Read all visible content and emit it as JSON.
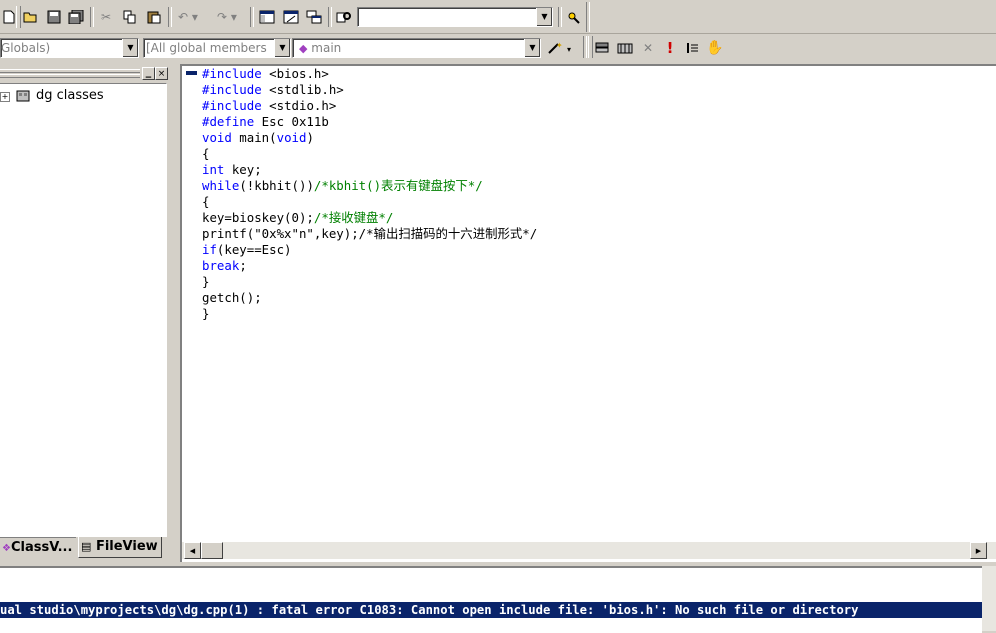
{
  "toolbar1": {
    "find_combo_value": "",
    "icons": [
      "new-file-icon",
      "open-icon",
      "save-icon",
      "save-all-icon",
      "cut-icon",
      "copy-icon",
      "paste-icon",
      "undo-icon",
      "redo-icon",
      "workspace-icon",
      "output-window-icon",
      "window-list-icon",
      "find-in-files-icon",
      "find-icon",
      "help-icon"
    ]
  },
  "toolbar2": {
    "scope_combo": "Globals)",
    "members_combo": "[All global members",
    "function_combo": "main",
    "icons": [
      "wizard-icon",
      "compile-icon",
      "build-icon",
      "stop-build-icon",
      "execute-icon",
      "breakpoint-icon",
      "go-icon"
    ]
  },
  "left_pane": {
    "tree_root": "dg classes",
    "tabs": [
      {
        "label": "ClassV...",
        "icon": "class-view-icon"
      },
      {
        "label": "FileView",
        "icon": "file-view-icon"
      }
    ]
  },
  "editor": {
    "lines": [
      [
        {
          "t": "#include",
          "c": "kw"
        },
        {
          "t": " <bios.h>"
        }
      ],
      [
        {
          "t": "#include",
          "c": "kw"
        },
        {
          "t": " <stdlib.h>"
        }
      ],
      [
        {
          "t": "#include",
          "c": "kw"
        },
        {
          "t": " <stdio.h>"
        }
      ],
      [
        {
          "t": "#define",
          "c": "kw"
        },
        {
          "t": " Esc 0x11b"
        }
      ],
      [
        {
          "t": "void",
          "c": "kw"
        },
        {
          "t": " main("
        },
        {
          "t": "void",
          "c": "kw"
        },
        {
          "t": ")"
        }
      ],
      [
        {
          "t": "{"
        }
      ],
      [
        {
          "t": "int",
          "c": "kw"
        },
        {
          "t": " key;"
        }
      ],
      [
        {
          "t": "while",
          "c": "kw"
        },
        {
          "t": "(!kbhit())"
        },
        {
          "t": "/*kbhit()表示有键盘按下*/",
          "c": "cm"
        }
      ],
      [
        {
          "t": "{"
        }
      ],
      [
        {
          "t": "key=bioskey(0);"
        },
        {
          "t": "/*接收键盘*/",
          "c": "cm"
        }
      ],
      [
        {
          "t": "printf(\"0x%x\"n\",key);/*输出扫描码的十六进制形式*/"
        }
      ],
      [
        {
          "t": "if",
          "c": "kw"
        },
        {
          "t": "(key==Esc)"
        }
      ],
      [
        {
          "t": "break",
          "c": "kw"
        },
        {
          "t": ";"
        }
      ],
      [
        {
          "t": "}"
        }
      ],
      [
        {
          "t": "getch();"
        }
      ],
      [
        {
          "t": "}"
        }
      ]
    ]
  },
  "output": {
    "error_line": "ual studio\\myprojects\\dg\\dg.cpp(1) : fatal error C1083: Cannot open include file: 'bios.h': No such file or directory"
  }
}
